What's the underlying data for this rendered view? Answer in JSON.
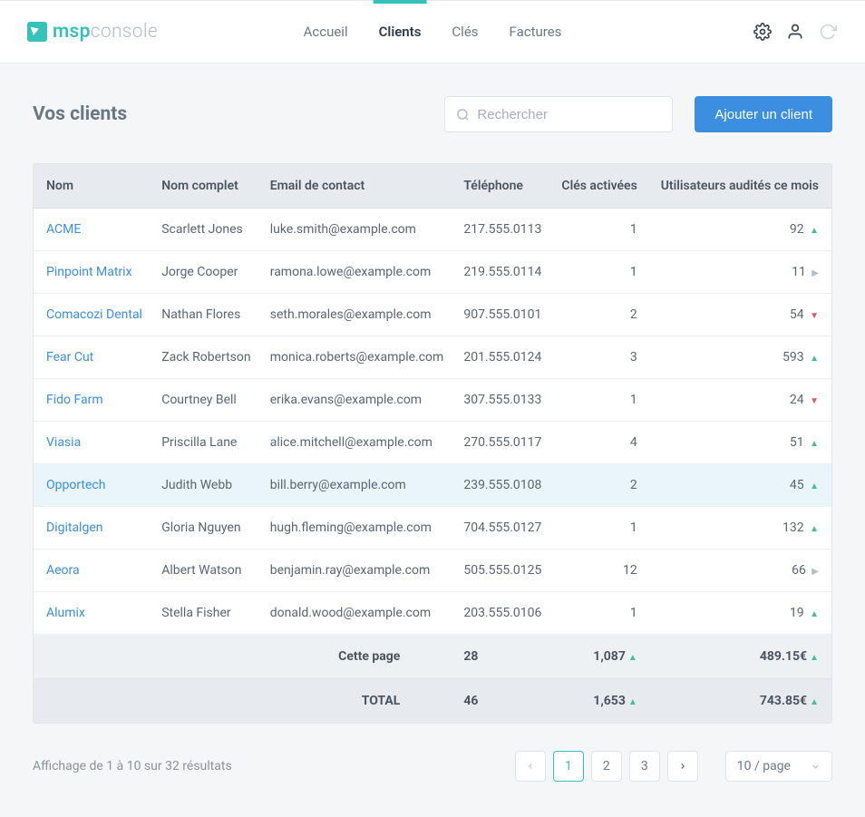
{
  "brand": {
    "strong": "msp",
    "light": "console"
  },
  "nav": {
    "items": [
      {
        "label": "Accueil",
        "active": false
      },
      {
        "label": "Clients",
        "active": true
      },
      {
        "label": "Clés",
        "active": false
      },
      {
        "label": "Factures",
        "active": false
      }
    ]
  },
  "page": {
    "title": "Vos clients",
    "search_placeholder": "Rechercher",
    "add_button": "Ajouter un client"
  },
  "table": {
    "columns": {
      "name": "Nom",
      "full_name": "Nom complet",
      "email": "Email de contact",
      "phone": "Téléphone",
      "keys": "Clés activées",
      "audits": "Utilisateurs audités ce mois"
    },
    "rows": [
      {
        "name": "ACME",
        "full_name": "Scarlett Jones",
        "email": "luke.smith@example.com",
        "phone": "217.555.0113",
        "keys": "1",
        "audits": "92",
        "trend": "up"
      },
      {
        "name": "Pinpoint Matrix",
        "full_name": "Jorge Cooper",
        "email": "ramona.lowe@example.com",
        "phone": "219.555.0114",
        "keys": "1",
        "audits": "11",
        "trend": "flat"
      },
      {
        "name": "Comacozi Dental",
        "full_name": "Nathan Flores",
        "email": "seth.morales@example.com",
        "phone": "907.555.0101",
        "keys": "2",
        "audits": "54",
        "trend": "down"
      },
      {
        "name": "Fear Cut",
        "full_name": "Zack Robertson",
        "email": "monica.roberts@example.com",
        "phone": "201.555.0124",
        "keys": "3",
        "audits": "593",
        "trend": "up"
      },
      {
        "name": "Fido Farm",
        "full_name": "Courtney Bell",
        "email": "erika.evans@example.com",
        "phone": "307.555.0133",
        "keys": "1",
        "audits": "24",
        "trend": "down"
      },
      {
        "name": "Viasia",
        "full_name": "Priscilla Lane",
        "email": "alice.mitchell@example.com",
        "phone": "270.555.0117",
        "keys": "4",
        "audits": "51",
        "trend": "up"
      },
      {
        "name": "Opportech",
        "full_name": "Judith Webb",
        "email": "bill.berry@example.com",
        "phone": "239.555.0108",
        "keys": "2",
        "audits": "45",
        "trend": "up",
        "highlight": true
      },
      {
        "name": "Digitalgen",
        "full_name": "Gloria Nguyen",
        "email": "hugh.fleming@example.com",
        "phone": "704.555.0127",
        "keys": "1",
        "audits": "132",
        "trend": "up"
      },
      {
        "name": "Aeora",
        "full_name": "Albert Watson",
        "email": "benjamin.ray@example.com",
        "phone": "505.555.0125",
        "keys": "12",
        "audits": "66",
        "trend": "flat"
      },
      {
        "name": "Alumix",
        "full_name": "Stella Fisher",
        "email": "donald.wood@example.com",
        "phone": "203.555.0106",
        "keys": "1",
        "audits": "19",
        "trend": "up"
      }
    ],
    "footer": {
      "page_label": "Cette page",
      "page_keys": "28",
      "page_audits": "1,087",
      "page_amount": "489.15€",
      "total_label": "TOTAL",
      "total_keys": "46",
      "total_audits": "1,653",
      "total_amount": "743.85€"
    }
  },
  "pagination": {
    "info": "Affichage de 1 à 10 sur 32 résultats",
    "pages": [
      "1",
      "2",
      "3"
    ],
    "active": "1",
    "page_size": "10 / page"
  }
}
